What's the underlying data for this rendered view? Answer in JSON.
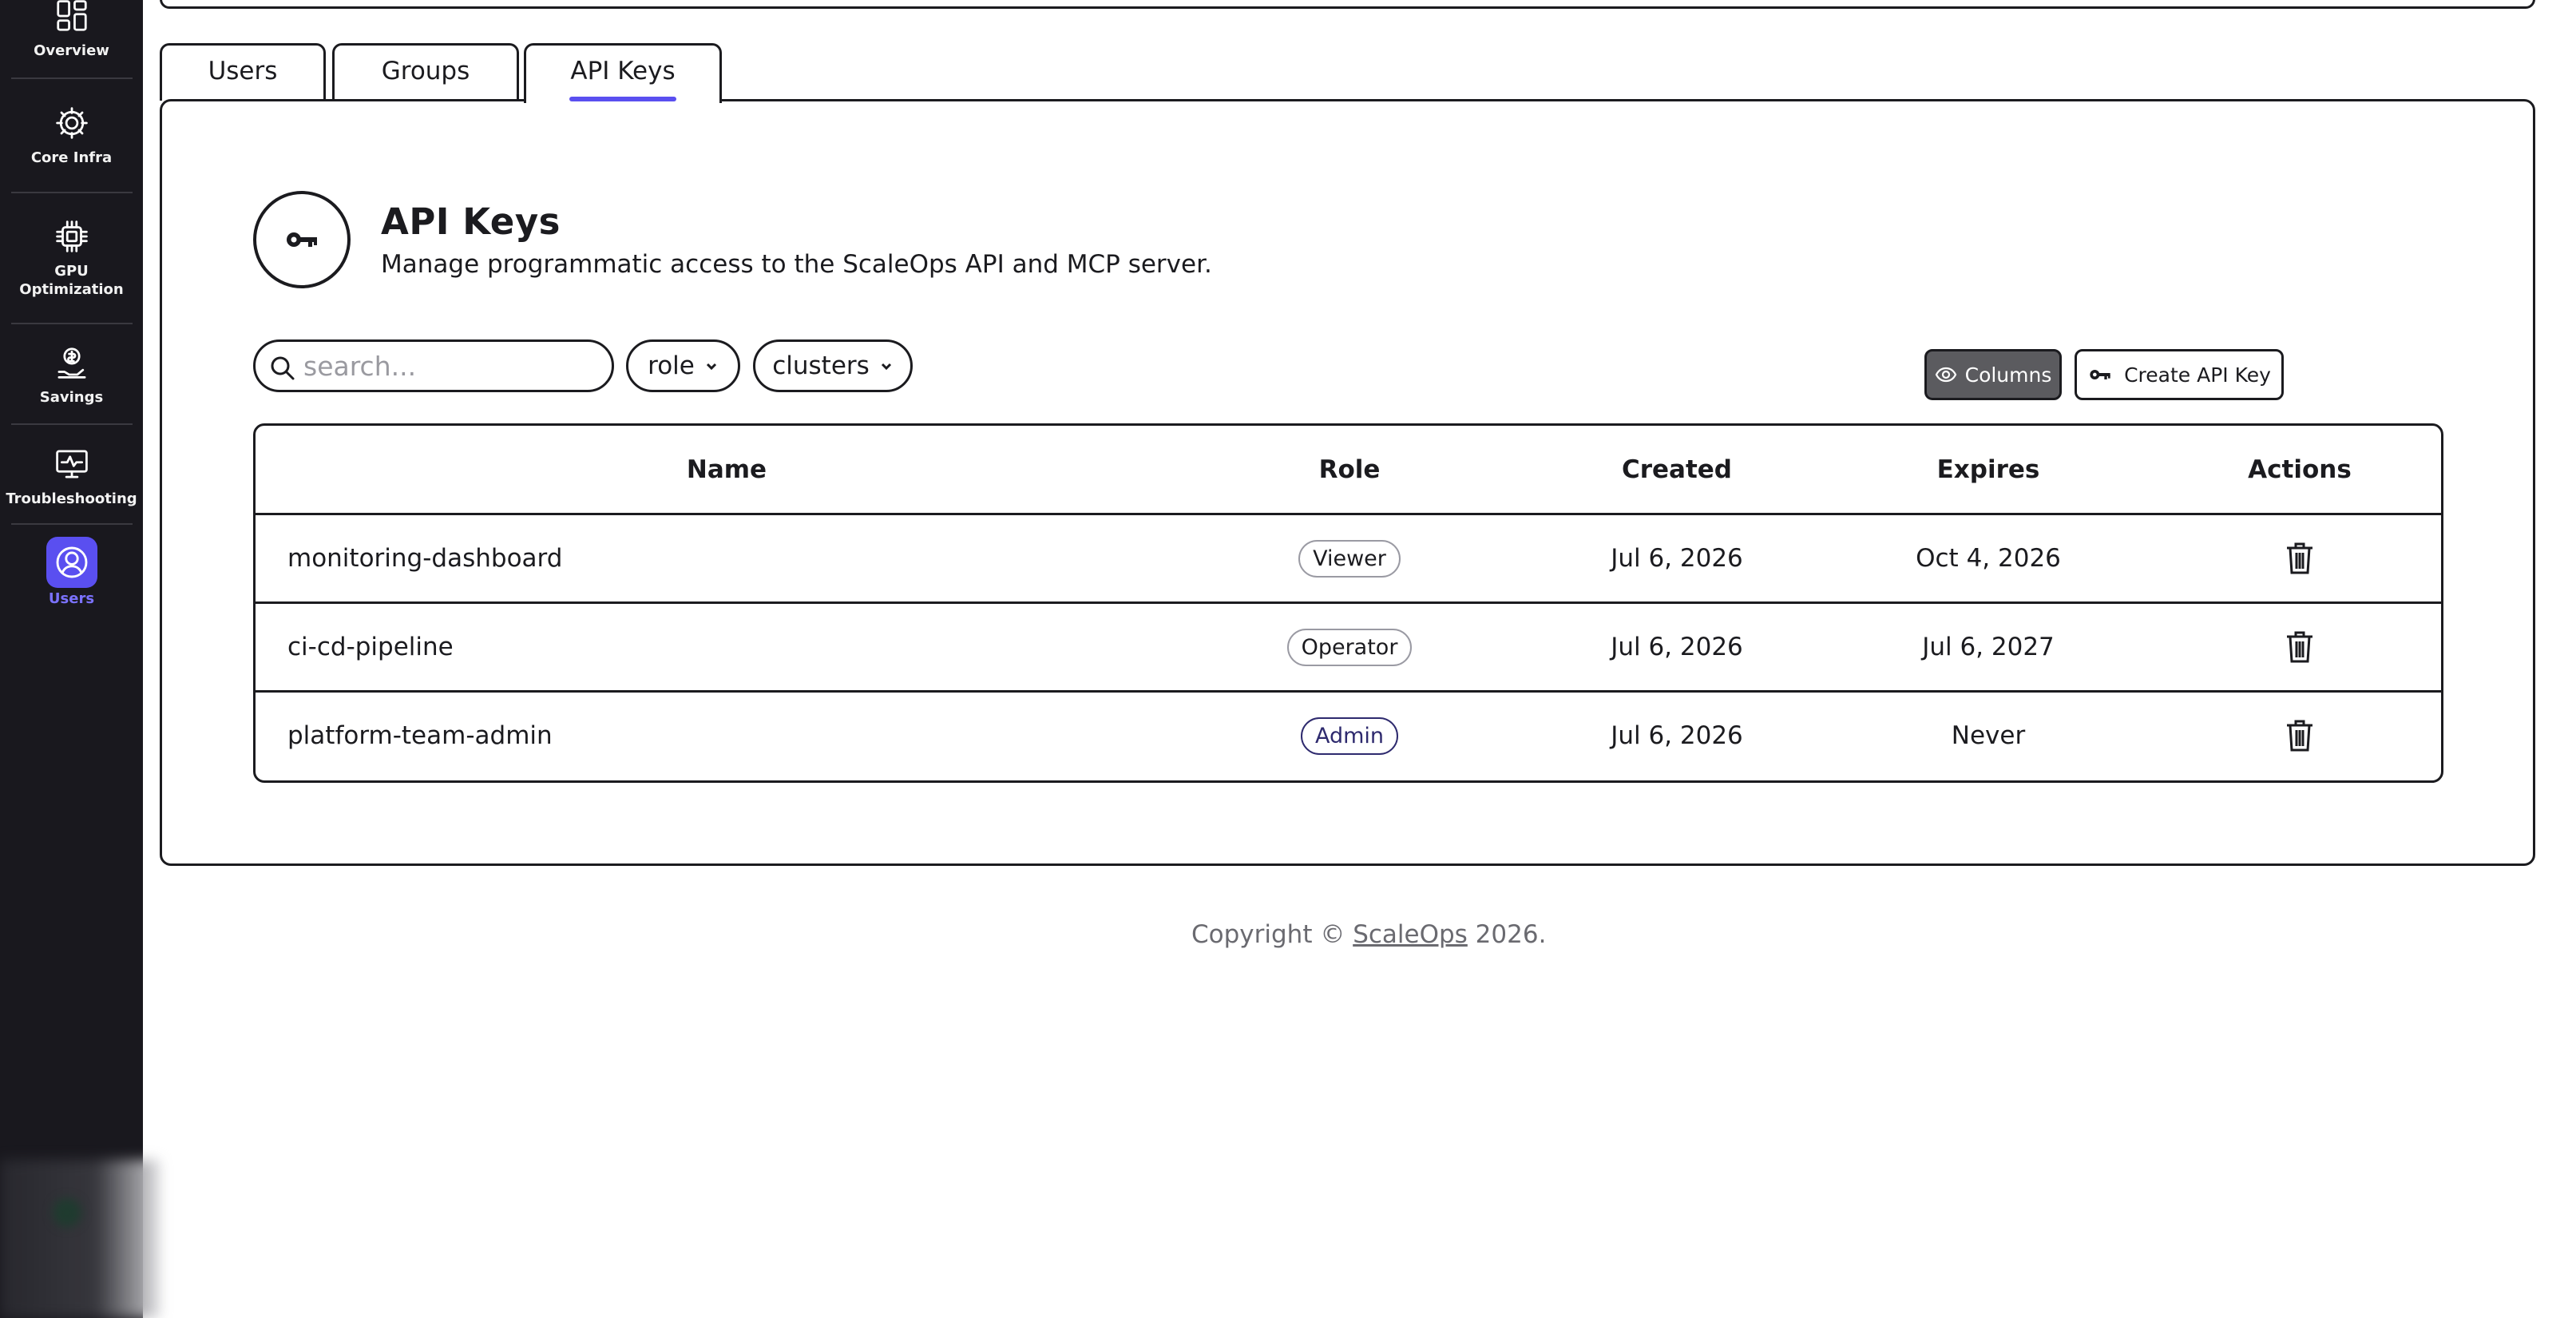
{
  "sidebar": {
    "items": [
      {
        "label": "Overview",
        "icon": "dashboard-icon"
      },
      {
        "label": "Core Infra",
        "icon": "gear-icon"
      },
      {
        "label": "GPU Optimization",
        "icon": "chip-icon"
      },
      {
        "label": "Savings",
        "icon": "money-hand-icon"
      },
      {
        "label": "Troubleshooting",
        "icon": "monitor-pulse-icon"
      },
      {
        "label": "Users",
        "icon": "user-circle-icon",
        "active": true
      }
    ]
  },
  "tabs": [
    {
      "label": "Users"
    },
    {
      "label": "Groups"
    },
    {
      "label": "API Keys",
      "active": true
    }
  ],
  "header": {
    "title": "API Keys",
    "subtitle": "Manage programmatic access to the ScaleOps API and MCP server."
  },
  "filters": {
    "search_placeholder": "search...",
    "role_label": "role",
    "clusters_label": "clusters"
  },
  "toolbar": {
    "columns_label": "Columns",
    "create_label": "Create API Key"
  },
  "table": {
    "columns": [
      "Name",
      "Role",
      "Created",
      "Expires",
      "Actions"
    ],
    "rows": [
      {
        "name": "monitoring-dashboard",
        "role": "Viewer",
        "created": "Jul 6, 2026",
        "expires": "Oct 4, 2026"
      },
      {
        "name": "ci-cd-pipeline",
        "role": "Operator",
        "created": "Jul 6, 2026",
        "expires": "Jul 6, 2027"
      },
      {
        "name": "platform-team-admin",
        "role": "Admin",
        "created": "Jul 6, 2026",
        "expires": "Never"
      }
    ]
  },
  "footer": {
    "prefix": "Copyright © ",
    "link": "ScaleOps",
    "suffix": " 2026."
  },
  "colors": {
    "sidebar_bg": "#19181e",
    "accent": "#5a4ff0",
    "columns_button_bg": "#5b5b5f"
  }
}
